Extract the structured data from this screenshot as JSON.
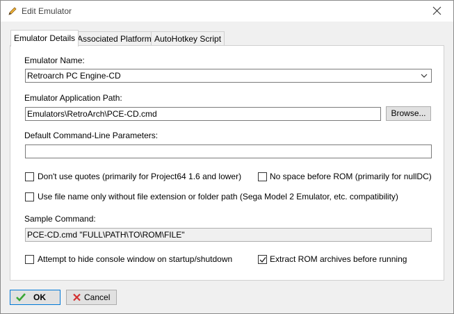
{
  "window": {
    "title": "Edit Emulator",
    "title_icon": "pencil-icon"
  },
  "tabs": [
    {
      "label": "Emulator Details",
      "active": true
    },
    {
      "label": "Associated Platforms",
      "active": false
    },
    {
      "label": "AutoHotkey Script",
      "active": false
    }
  ],
  "details": {
    "name_label": "Emulator Name:",
    "name_value": "Retroarch PC Engine-CD",
    "path_label": "Emulator Application Path:",
    "path_value": "Emulators\\RetroArch\\PCE-CD.cmd",
    "browse_label": "Browse...",
    "params_label": "Default Command-Line Parameters:",
    "params_value": "",
    "options": {
      "no_quotes": {
        "label": "Don't use quotes (primarily for Project64 1.6 and lower)",
        "checked": false
      },
      "no_space": {
        "label": "No space before ROM (primarily for nullDC)",
        "checked": false
      },
      "file_name_only": {
        "label": "Use file name only without file extension or folder path (Sega Model 2 Emulator, etc. compatibility)",
        "checked": false
      },
      "hide_console": {
        "label": "Attempt to hide console window on startup/shutdown",
        "checked": false
      },
      "extract_rom": {
        "label": "Extract ROM archives before running",
        "checked": true
      }
    },
    "sample_label": "Sample Command:",
    "sample_value": "PCE-CD.cmd \"FULL\\PATH\\TO\\ROM\\FILE\""
  },
  "footer": {
    "ok_label": "OK",
    "cancel_label": "Cancel",
    "ok_icon": "checkmark-icon",
    "cancel_icon": "red-x-icon"
  },
  "colors": {
    "ok_green": "#3aa635",
    "cancel_red": "#d32f2f",
    "focus_blue": "#0078d7"
  }
}
